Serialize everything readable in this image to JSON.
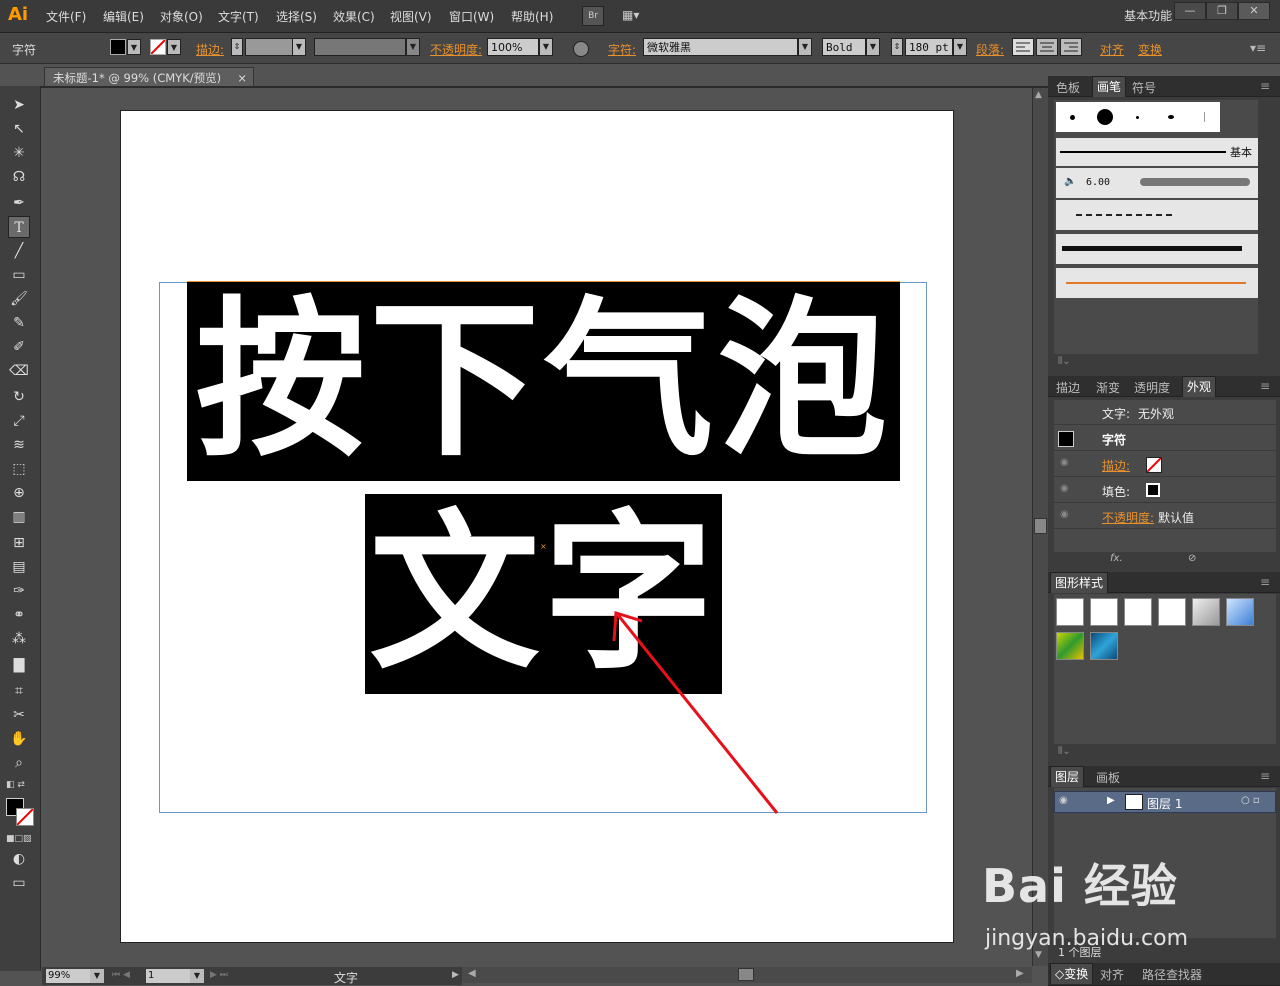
{
  "app": {
    "logo": "Ai"
  },
  "menu": [
    "文件(F)",
    "编辑(E)",
    "对象(O)",
    "文字(T)",
    "选择(S)",
    "效果(C)",
    "视图(V)",
    "窗口(W)",
    "帮助(H)"
  ],
  "bridge_button": "Br",
  "workspace": "基本功能",
  "control": {
    "mode_label": "字符",
    "stroke_label": "描边:",
    "opacity_label": "不透明度:",
    "opacity_value": "100%",
    "char_label": "字符:",
    "font_value": "微软雅黑",
    "style_value": "Bold",
    "size_value": "180 pt",
    "para_label": "段落:",
    "align_label": "对齐",
    "transform_label": "变换"
  },
  "document": {
    "tab_title": "未标题-1* @ 99% (CMYK/预览)",
    "tab_close": "×",
    "line1": "按下气泡",
    "line2": "文字"
  },
  "status": {
    "zoom": "99%",
    "page": "1",
    "tool_name": "文字"
  },
  "panels": {
    "top_tabs": [
      "色板",
      "画笔",
      "符号"
    ],
    "brush_basic": "基本",
    "brush_size": "6.00",
    "mid_tabs": [
      "描边",
      "渐变",
      "透明度",
      "外观"
    ],
    "appearance": {
      "header_label": "文字:",
      "header_value": "无外观",
      "char_row": "字符",
      "stroke_label": "描边:",
      "fill_label": "填色:",
      "opacity_label": "不透明度:",
      "opacity_value": "默认值",
      "fx": "fx."
    },
    "graphic_styles_title": "图形样式",
    "layers_tabs": [
      "图层",
      "画板"
    ],
    "layer_name": "图层 1",
    "layer_count": "1 个图层",
    "bottom_tabs": [
      "变换",
      "对齐",
      "路径查找器"
    ]
  },
  "watermark": {
    "logo_text": "Bai 经验",
    "url": "jingyan.baidu.com"
  },
  "colors": {
    "accent_orange": "#e8912d",
    "arrow_red": "#e8101a",
    "frame_blue": "#6b97c7"
  }
}
